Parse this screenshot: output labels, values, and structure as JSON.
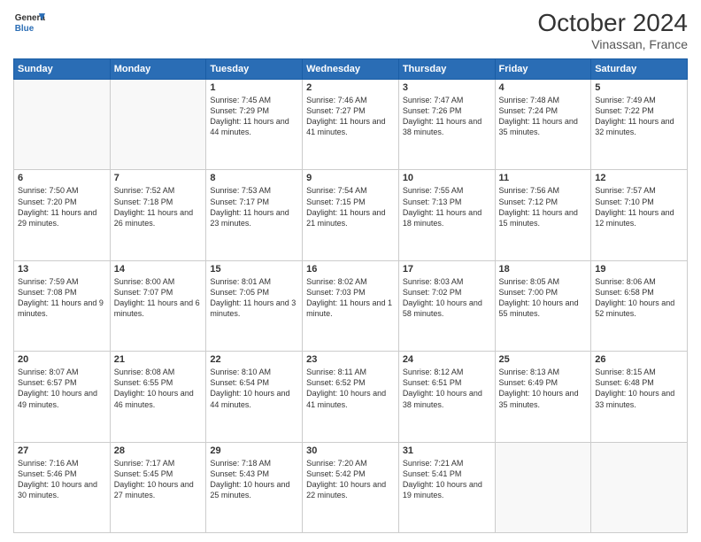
{
  "header": {
    "logo_line1": "General",
    "logo_line2": "Blue",
    "month": "October 2024",
    "location": "Vinassan, France"
  },
  "weekdays": [
    "Sunday",
    "Monday",
    "Tuesday",
    "Wednesday",
    "Thursday",
    "Friday",
    "Saturday"
  ],
  "weeks": [
    [
      {
        "day": "",
        "empty": true
      },
      {
        "day": "",
        "empty": true
      },
      {
        "day": "1",
        "sunrise": "Sunrise: 7:45 AM",
        "sunset": "Sunset: 7:29 PM",
        "daylight": "Daylight: 11 hours and 44 minutes."
      },
      {
        "day": "2",
        "sunrise": "Sunrise: 7:46 AM",
        "sunset": "Sunset: 7:27 PM",
        "daylight": "Daylight: 11 hours and 41 minutes."
      },
      {
        "day": "3",
        "sunrise": "Sunrise: 7:47 AM",
        "sunset": "Sunset: 7:26 PM",
        "daylight": "Daylight: 11 hours and 38 minutes."
      },
      {
        "day": "4",
        "sunrise": "Sunrise: 7:48 AM",
        "sunset": "Sunset: 7:24 PM",
        "daylight": "Daylight: 11 hours and 35 minutes."
      },
      {
        "day": "5",
        "sunrise": "Sunrise: 7:49 AM",
        "sunset": "Sunset: 7:22 PM",
        "daylight": "Daylight: 11 hours and 32 minutes."
      }
    ],
    [
      {
        "day": "6",
        "sunrise": "Sunrise: 7:50 AM",
        "sunset": "Sunset: 7:20 PM",
        "daylight": "Daylight: 11 hours and 29 minutes."
      },
      {
        "day": "7",
        "sunrise": "Sunrise: 7:52 AM",
        "sunset": "Sunset: 7:18 PM",
        "daylight": "Daylight: 11 hours and 26 minutes."
      },
      {
        "day": "8",
        "sunrise": "Sunrise: 7:53 AM",
        "sunset": "Sunset: 7:17 PM",
        "daylight": "Daylight: 11 hours and 23 minutes."
      },
      {
        "day": "9",
        "sunrise": "Sunrise: 7:54 AM",
        "sunset": "Sunset: 7:15 PM",
        "daylight": "Daylight: 11 hours and 21 minutes."
      },
      {
        "day": "10",
        "sunrise": "Sunrise: 7:55 AM",
        "sunset": "Sunset: 7:13 PM",
        "daylight": "Daylight: 11 hours and 18 minutes."
      },
      {
        "day": "11",
        "sunrise": "Sunrise: 7:56 AM",
        "sunset": "Sunset: 7:12 PM",
        "daylight": "Daylight: 11 hours and 15 minutes."
      },
      {
        "day": "12",
        "sunrise": "Sunrise: 7:57 AM",
        "sunset": "Sunset: 7:10 PM",
        "daylight": "Daylight: 11 hours and 12 minutes."
      }
    ],
    [
      {
        "day": "13",
        "sunrise": "Sunrise: 7:59 AM",
        "sunset": "Sunset: 7:08 PM",
        "daylight": "Daylight: 11 hours and 9 minutes."
      },
      {
        "day": "14",
        "sunrise": "Sunrise: 8:00 AM",
        "sunset": "Sunset: 7:07 PM",
        "daylight": "Daylight: 11 hours and 6 minutes."
      },
      {
        "day": "15",
        "sunrise": "Sunrise: 8:01 AM",
        "sunset": "Sunset: 7:05 PM",
        "daylight": "Daylight: 11 hours and 3 minutes."
      },
      {
        "day": "16",
        "sunrise": "Sunrise: 8:02 AM",
        "sunset": "Sunset: 7:03 PM",
        "daylight": "Daylight: 11 hours and 1 minute."
      },
      {
        "day": "17",
        "sunrise": "Sunrise: 8:03 AM",
        "sunset": "Sunset: 7:02 PM",
        "daylight": "Daylight: 10 hours and 58 minutes."
      },
      {
        "day": "18",
        "sunrise": "Sunrise: 8:05 AM",
        "sunset": "Sunset: 7:00 PM",
        "daylight": "Daylight: 10 hours and 55 minutes."
      },
      {
        "day": "19",
        "sunrise": "Sunrise: 8:06 AM",
        "sunset": "Sunset: 6:58 PM",
        "daylight": "Daylight: 10 hours and 52 minutes."
      }
    ],
    [
      {
        "day": "20",
        "sunrise": "Sunrise: 8:07 AM",
        "sunset": "Sunset: 6:57 PM",
        "daylight": "Daylight: 10 hours and 49 minutes."
      },
      {
        "day": "21",
        "sunrise": "Sunrise: 8:08 AM",
        "sunset": "Sunset: 6:55 PM",
        "daylight": "Daylight: 10 hours and 46 minutes."
      },
      {
        "day": "22",
        "sunrise": "Sunrise: 8:10 AM",
        "sunset": "Sunset: 6:54 PM",
        "daylight": "Daylight: 10 hours and 44 minutes."
      },
      {
        "day": "23",
        "sunrise": "Sunrise: 8:11 AM",
        "sunset": "Sunset: 6:52 PM",
        "daylight": "Daylight: 10 hours and 41 minutes."
      },
      {
        "day": "24",
        "sunrise": "Sunrise: 8:12 AM",
        "sunset": "Sunset: 6:51 PM",
        "daylight": "Daylight: 10 hours and 38 minutes."
      },
      {
        "day": "25",
        "sunrise": "Sunrise: 8:13 AM",
        "sunset": "Sunset: 6:49 PM",
        "daylight": "Daylight: 10 hours and 35 minutes."
      },
      {
        "day": "26",
        "sunrise": "Sunrise: 8:15 AM",
        "sunset": "Sunset: 6:48 PM",
        "daylight": "Daylight: 10 hours and 33 minutes."
      }
    ],
    [
      {
        "day": "27",
        "sunrise": "Sunrise: 7:16 AM",
        "sunset": "Sunset: 5:46 PM",
        "daylight": "Daylight: 10 hours and 30 minutes."
      },
      {
        "day": "28",
        "sunrise": "Sunrise: 7:17 AM",
        "sunset": "Sunset: 5:45 PM",
        "daylight": "Daylight: 10 hours and 27 minutes."
      },
      {
        "day": "29",
        "sunrise": "Sunrise: 7:18 AM",
        "sunset": "Sunset: 5:43 PM",
        "daylight": "Daylight: 10 hours and 25 minutes."
      },
      {
        "day": "30",
        "sunrise": "Sunrise: 7:20 AM",
        "sunset": "Sunset: 5:42 PM",
        "daylight": "Daylight: 10 hours and 22 minutes."
      },
      {
        "day": "31",
        "sunrise": "Sunrise: 7:21 AM",
        "sunset": "Sunset: 5:41 PM",
        "daylight": "Daylight: 10 hours and 19 minutes."
      },
      {
        "day": "",
        "empty": true
      },
      {
        "day": "",
        "empty": true
      }
    ]
  ]
}
